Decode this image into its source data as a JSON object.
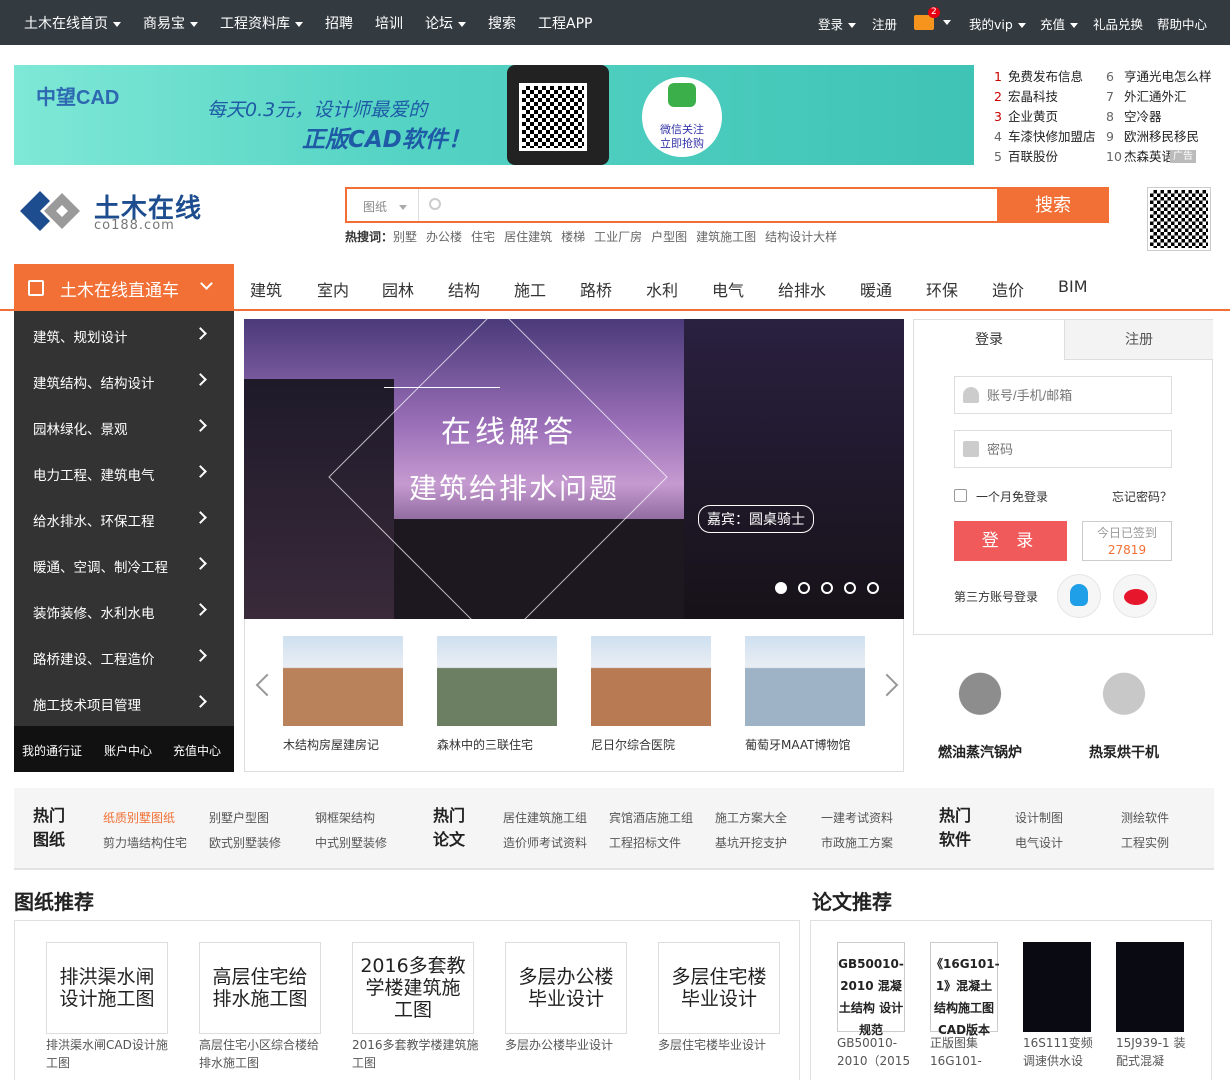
{
  "topnav": {
    "left": [
      {
        "label": "土木在线首页",
        "dropdown": true
      },
      {
        "label": "商易宝",
        "dropdown": true
      },
      {
        "label": "工程资料库",
        "dropdown": true
      },
      {
        "label": "招聘",
        "dropdown": false
      },
      {
        "label": "培训",
        "dropdown": false
      },
      {
        "label": "论坛",
        "dropdown": true
      },
      {
        "label": "搜索",
        "dropdown": false
      },
      {
        "label": "工程APP",
        "dropdown": false
      }
    ],
    "right": {
      "login": "登录",
      "register": "注册",
      "mail_badge": "2",
      "vip": "我的vip",
      "recharge": "充值",
      "gift": "礼品兑换",
      "help": "帮助中心"
    }
  },
  "banner": {
    "brand": "中望CAD",
    "slogan1": "每天0.3元，设计师最爱的",
    "slogan2": "正版CAD软件！",
    "wechat_line1": "微信关注",
    "wechat_line2": "立即抢购"
  },
  "ad_list": {
    "col1": [
      {
        "n": "1",
        "t": "免费发布信息"
      },
      {
        "n": "2",
        "t": "宏晶科技"
      },
      {
        "n": "3",
        "t": "企业黄页"
      },
      {
        "n": "4",
        "t": "车漆快修加盟店"
      },
      {
        "n": "5",
        "t": "百联股份"
      }
    ],
    "col2": [
      {
        "n": "6",
        "t": "亨通光电怎么样"
      },
      {
        "n": "7",
        "t": "外汇通外汇"
      },
      {
        "n": "8",
        "t": "空冷器"
      },
      {
        "n": "9",
        "t": "欧洲移民移民"
      },
      {
        "n": "10",
        "t": "杰森英语"
      }
    ],
    "tag": "广告"
  },
  "logo": {
    "name": "土木在线",
    "domain": "co188.com"
  },
  "search": {
    "category": "图纸",
    "placeholder": "",
    "button": "搜索",
    "hot_label": "热搜词：",
    "hot_words": [
      "别墅",
      "办公楼",
      "住宅",
      "居住建筑",
      "楼梯",
      "工业厂房",
      "户型图",
      "建筑施工图",
      "结构设计大样"
    ]
  },
  "channel": {
    "title": "土木在线直通车",
    "links": [
      "建筑",
      "室内",
      "园林",
      "结构",
      "施工",
      "路桥",
      "水利",
      "电气",
      "给排水",
      "暖通",
      "环保",
      "造价",
      "BIM"
    ]
  },
  "sidebar": {
    "items": [
      "建筑、规划设计",
      "建筑结构、结构设计",
      "园林绿化、景观",
      "电力工程、建筑电气",
      "给水排水、环保工程",
      "暖通、空调、制冷工程",
      "装饰装修、水利水电",
      "路桥建设、工程造价",
      "施工技术项目管理"
    ],
    "bottom": [
      "我的通行证",
      "账户中心",
      "充值中心"
    ]
  },
  "hero": {
    "line1": "在线解答",
    "line2": "建筑给排水问题",
    "guest": "嘉宾：圆桌骑士",
    "slides": 5,
    "active": 1
  },
  "thumbs": [
    {
      "caption": "木结构房屋建房记",
      "color": "#b9825a"
    },
    {
      "caption": "森林中的三联住宅",
      "color": "#6d7f63"
    },
    {
      "caption": "尼日尔综合医院",
      "color": "#b87a52"
    },
    {
      "caption": "葡萄牙MAAT博物馆",
      "color": "#9fb3c6"
    }
  ],
  "login": {
    "tab_login": "登录",
    "tab_register": "注册",
    "user_placeholder": "账号/手机/邮箱",
    "pass_placeholder": "密码",
    "remember": "一个月免登录",
    "forgot": "忘记密码？",
    "submit": "登 录",
    "signed_label": "今日已签到",
    "signed_count": "27819",
    "third_party": "第三方账号登录"
  },
  "products": [
    {
      "label": "燃油蒸汽锅炉",
      "color": "#8d8d8d"
    },
    {
      "label": "热泵烘干机",
      "color": "#c8c8c8"
    }
  ],
  "hotbar": {
    "groups": [
      {
        "h1": "热门",
        "h2": "图纸",
        "row1": [
          "纸质别墅图纸",
          "别墅户型图",
          "钢框架结构"
        ],
        "row2": [
          "剪力墙结构住宅",
          "欧式别墅装修",
          "中式别墅装修"
        ]
      },
      {
        "h1": "热门",
        "h2": "论文",
        "row1": [
          "居住建筑施工组",
          "宾馆酒店施工组",
          "施工方案大全",
          "一建考试资料"
        ],
        "row2": [
          "造价师考试资料",
          "工程招标文件",
          "基坑开挖支护",
          "市政施工方案"
        ]
      },
      {
        "h1": "热门",
        "h2": "软件",
        "row1": [
          "设计制图",
          "测绘软件"
        ],
        "row2": [
          "电气设计",
          "工程实例"
        ]
      }
    ]
  },
  "drawings": {
    "title": "图纸推荐",
    "items": [
      {
        "cover": "排洪渠水闸设计施工图",
        "caption": "排洪渠水闸CAD设计施工图"
      },
      {
        "cover": "高层住宅给排水施工图",
        "caption": "高层住宅小区综合楼给排水施工图"
      },
      {
        "cover": "2016多套教学楼建筑施工图",
        "caption": "2016多套教学楼建筑施工图"
      },
      {
        "cover": "多层办公楼毕业设计",
        "caption": "多层办公楼毕业设计"
      },
      {
        "cover": "多层住宅楼毕业设计",
        "caption": "多层住宅楼毕业设计"
      }
    ]
  },
  "papers": {
    "title": "论文推荐",
    "items": [
      {
        "cover": "GB50010-2010 混凝土结构 设计规范",
        "caption": "GB50010-2010（2015",
        "dark": false
      },
      {
        "cover": "《16G101-1》混凝土结构施工图 CAD版本",
        "caption": "正版图集16G101-",
        "dark": false
      },
      {
        "cover": "",
        "caption": "16S111变频调速供水设",
        "dark": true
      },
      {
        "cover": "",
        "caption": "15J939-1 装配式混凝",
        "dark": true
      }
    ]
  }
}
